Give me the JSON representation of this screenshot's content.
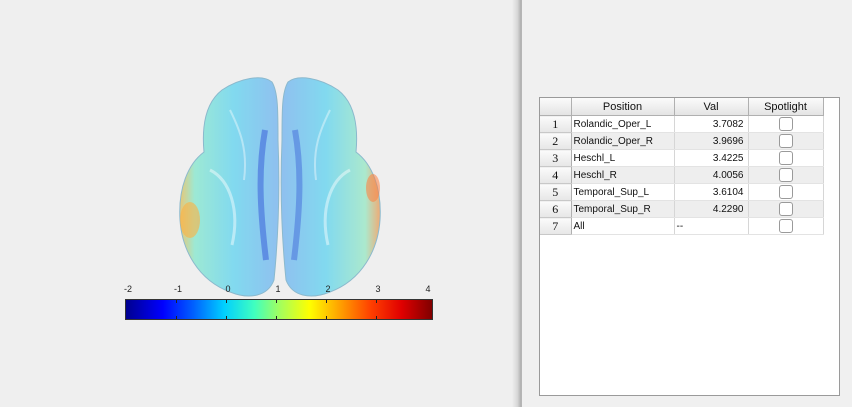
{
  "colorbar": {
    "ticks": [
      "-2",
      "-1",
      "0",
      "1",
      "2",
      "3",
      "4"
    ],
    "colormap": "jet"
  },
  "table": {
    "headers": {
      "position": "Position",
      "val": "Val",
      "spotlight": "Spotlight"
    },
    "rows": [
      {
        "index": "1",
        "position": "Rolandic_Oper_L",
        "val": "3.7082",
        "spotlight": false
      },
      {
        "index": "2",
        "position": "Rolandic_Oper_R",
        "val": "3.9696",
        "spotlight": false
      },
      {
        "index": "3",
        "position": "Heschl_L",
        "val": "3.4225",
        "spotlight": false
      },
      {
        "index": "4",
        "position": "Heschl_R",
        "val": "4.0056",
        "spotlight": false
      },
      {
        "index": "5",
        "position": "Temporal_Sup_L",
        "val": "3.6104",
        "spotlight": false
      },
      {
        "index": "6",
        "position": "Temporal_Sup_R",
        "val": "4.2290",
        "spotlight": false
      },
      {
        "index": "7",
        "position": "All",
        "val": "--",
        "spotlight": false
      }
    ]
  }
}
